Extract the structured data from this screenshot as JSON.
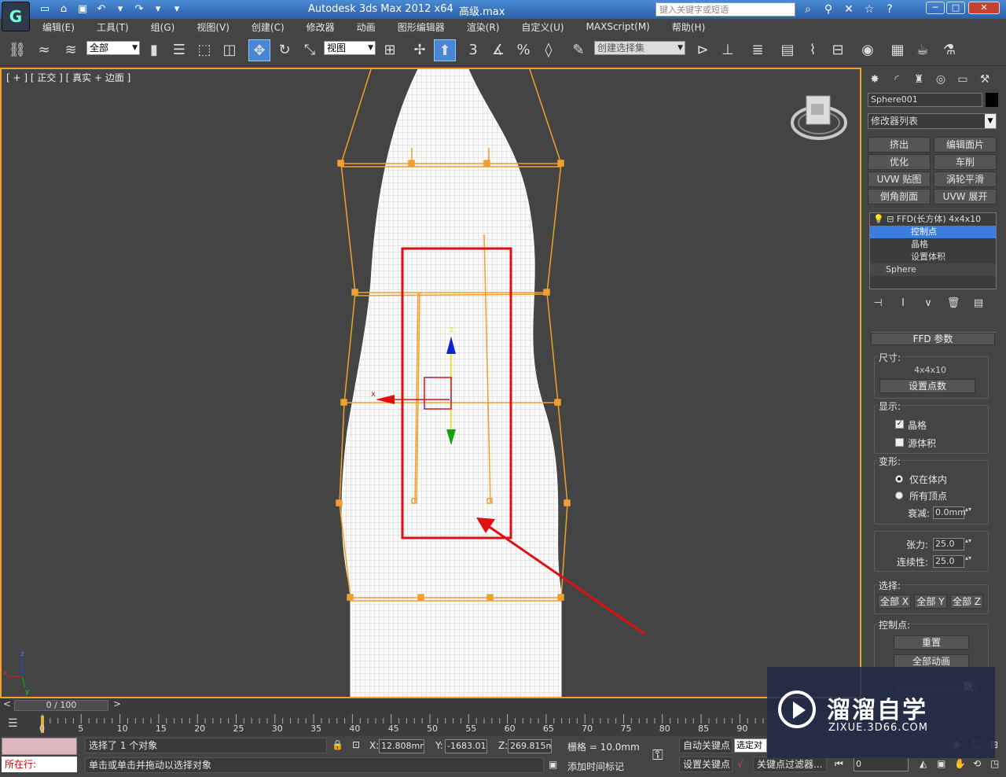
{
  "titlebar": {
    "app_title": "Autodesk 3ds Max  2012 x64",
    "file_name": "高级.max",
    "search_placeholder": "键入关键字或短语",
    "minimize": "─",
    "maximize": "□",
    "close": "✕"
  },
  "menu": [
    "编辑(E)",
    "工具(T)",
    "组(G)",
    "视图(V)",
    "创建(C)",
    "修改器",
    "动画",
    "图形编辑器",
    "渲染(R)",
    "自定义(U)",
    "MAXScript(M)",
    "帮助(H)"
  ],
  "toolbar": {
    "filter_value": "全部",
    "coord_value": "视图",
    "snap_label": "3",
    "named_selection_placeholder": "创建选择集"
  },
  "viewport": {
    "label": "[ + ] [ 正交 ] [ 真实 + 边面 ]",
    "gizmo_x_label": "x",
    "gizmo_z_label": "z",
    "axis_z_label": "z",
    "axis_x_label": "x",
    "axis_y_label": "y",
    "wire_color": "#f5f5f5",
    "lattice_color": "#f0a030",
    "highlight_color": "#e01010"
  },
  "command_panel": {
    "object_name": "Sphere001",
    "modifier_list": "修改器列表",
    "modifier_buttons": [
      "挤出",
      "编辑面片",
      "优化",
      "车削",
      "UVW 贴图",
      "涡轮平滑",
      "倒角剖面",
      "UVW 展开"
    ],
    "stack": {
      "modifier": "FFD(长方体) 4x4x10",
      "sub_items": [
        "控制点",
        "晶格",
        "设置体积"
      ],
      "base": "Sphere"
    },
    "rollout_title": "FFD 参数",
    "dimensions_label": "尺寸:",
    "dimensions_value": "4x4x10",
    "set_points_button": "设置点数",
    "display_label": "显示:",
    "lattice_check": "晶格",
    "lattice_checked": true,
    "source_volume_check": "源体积",
    "source_volume_checked": false,
    "deform_label": "变形:",
    "only_in_volume": "仅在体内",
    "all_vertices": "所有顶点",
    "falloff_label": "衰减:",
    "falloff_value": "0.0mm",
    "tension_label": "张力:",
    "tension_value": "25.0",
    "continuity_label": "连续性:",
    "continuity_value": "25.0",
    "selection_label": "选择:",
    "select_x": "全部 X",
    "select_y": "全部 Y",
    "select_z": "全部 Z",
    "control_points_label": "控制点:",
    "reset_button": "重置",
    "animate_all_button": "全部动画",
    "cut_button_text": "数"
  },
  "timeline": {
    "frame_display": "0 / 100",
    "ticks": [
      "0",
      "5",
      "10",
      "15",
      "20",
      "25",
      "30",
      "35",
      "40",
      "45",
      "50",
      "55",
      "60",
      "65",
      "70",
      "75",
      "80",
      "85",
      "90"
    ]
  },
  "statusbar": {
    "script_label": "所在行:",
    "selection_status": "选择了 1 个对象",
    "prompt": "单击或单击并拖动以选择对象",
    "x_label": "X:",
    "x_value": "12.808mm",
    "y_label": "Y:",
    "y_value": "-1683.011",
    "z_label": "Z:",
    "z_value": "269.815mm",
    "grid": "栅格 = 10.0mm",
    "add_time_tag": "添加时间标记",
    "auto_key": "自动关键点",
    "set_key": "设置关键点",
    "selected_dropdown": "选定对",
    "key_filter": "关键点过滤器...",
    "frame_value": "0"
  },
  "watermark": {
    "cn": "溜溜自学",
    "en": "ZIXUE.3D66.COM"
  }
}
